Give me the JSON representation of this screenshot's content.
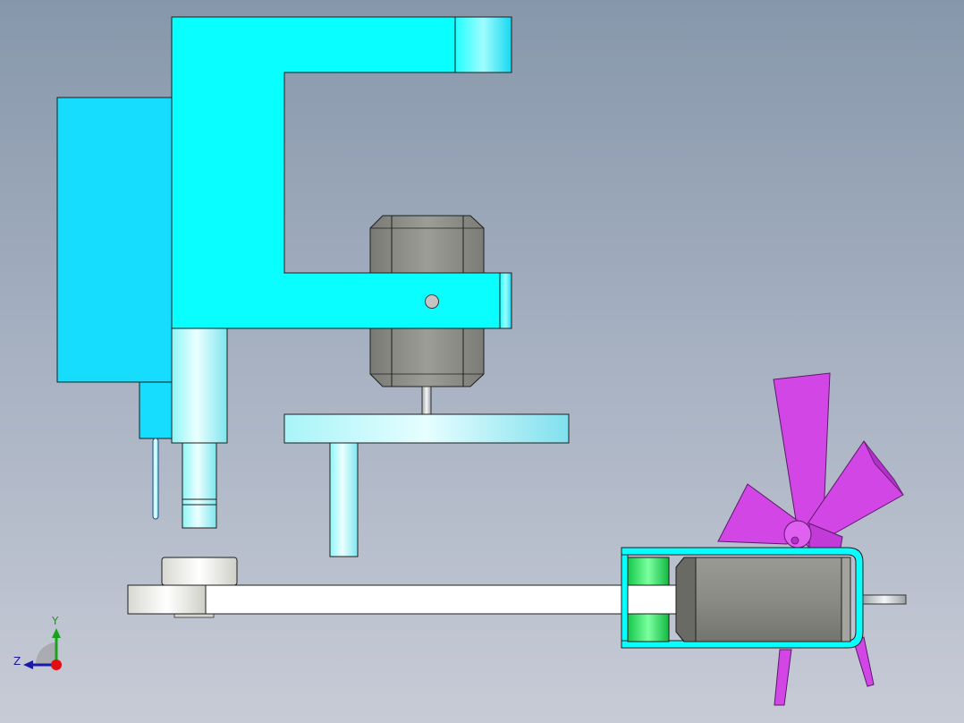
{
  "viewport": {
    "background_top": "#8797ab",
    "background_bottom": "#c7cbd6"
  },
  "colors": {
    "frame": "#09ffff",
    "frame_side": "#16dcfd",
    "motor_body": "#8e8e88",
    "metal_light": "#f5f5f5",
    "fan_blade": "#d346e6",
    "fan_blade_dark": "#b030c8",
    "green_bushing": "#2ae85a",
    "outline": "#1e1e1e"
  },
  "triad": {
    "y_label": "Y",
    "z_label": "Z",
    "y_axis_color": "#1aa31a",
    "z_axis_color": "#1a1aa8",
    "origin_color": "#e01010"
  },
  "scene": {
    "parts": [
      "c-frame",
      "side-block",
      "vertical-motor",
      "spindle",
      "horizontal-disc",
      "connecting-rod",
      "fan-motor",
      "fan-propeller",
      "green-bushing"
    ]
  }
}
